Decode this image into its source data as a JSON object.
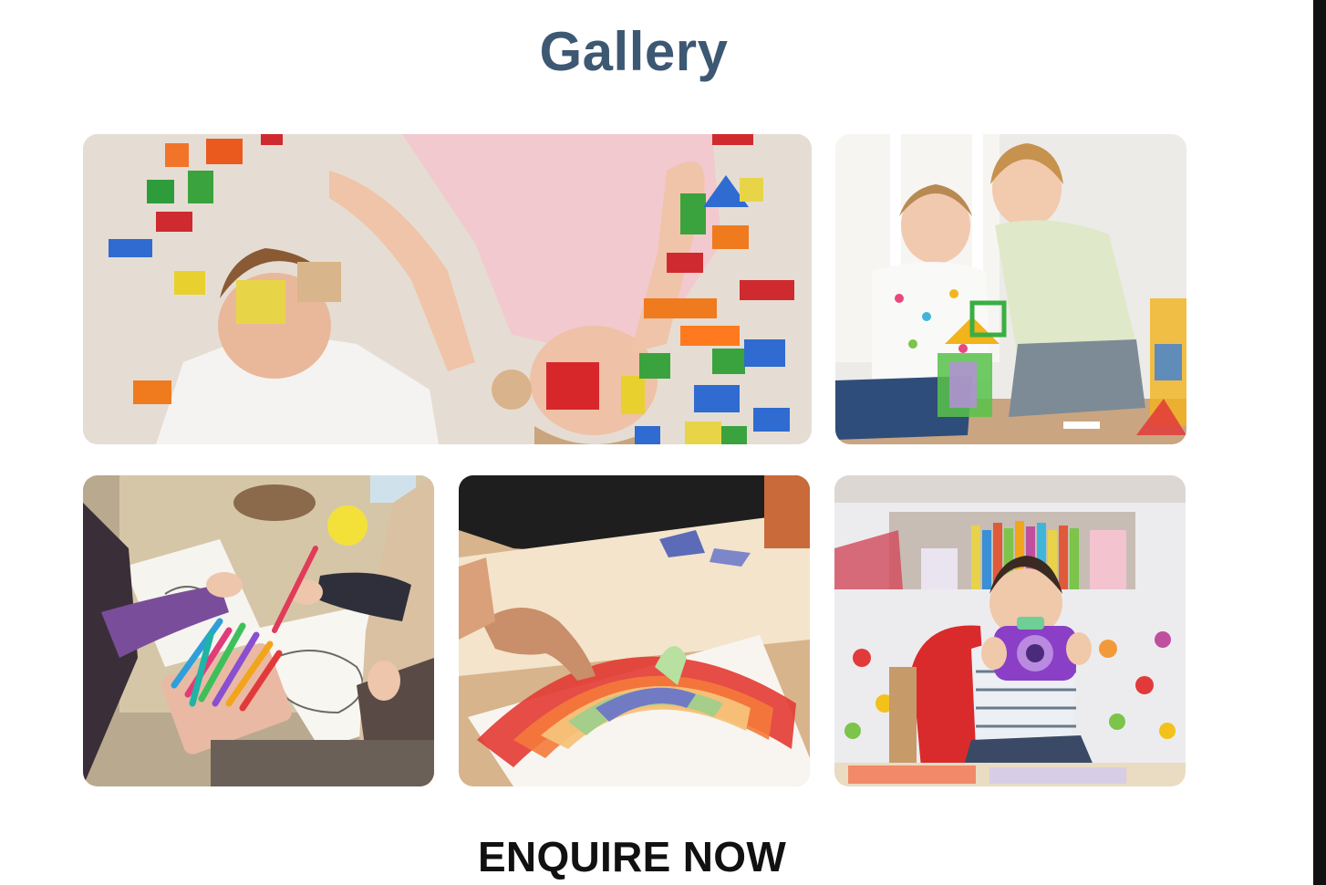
{
  "gallery": {
    "title": "Gallery",
    "images": [
      {
        "name": "children-playing-with-wooden-blocks"
      },
      {
        "name": "children-building-magnetic-tiles"
      },
      {
        "name": "children-coloring-with-markers"
      },
      {
        "name": "child-making-paper-rainbow-collage"
      },
      {
        "name": "toddler-playing-with-toy-camera"
      }
    ]
  },
  "cta": {
    "label": "ENQUIRE NOW"
  },
  "colors": {
    "title": "#3d5872",
    "cta": "#111111",
    "background": "#ffffff"
  }
}
